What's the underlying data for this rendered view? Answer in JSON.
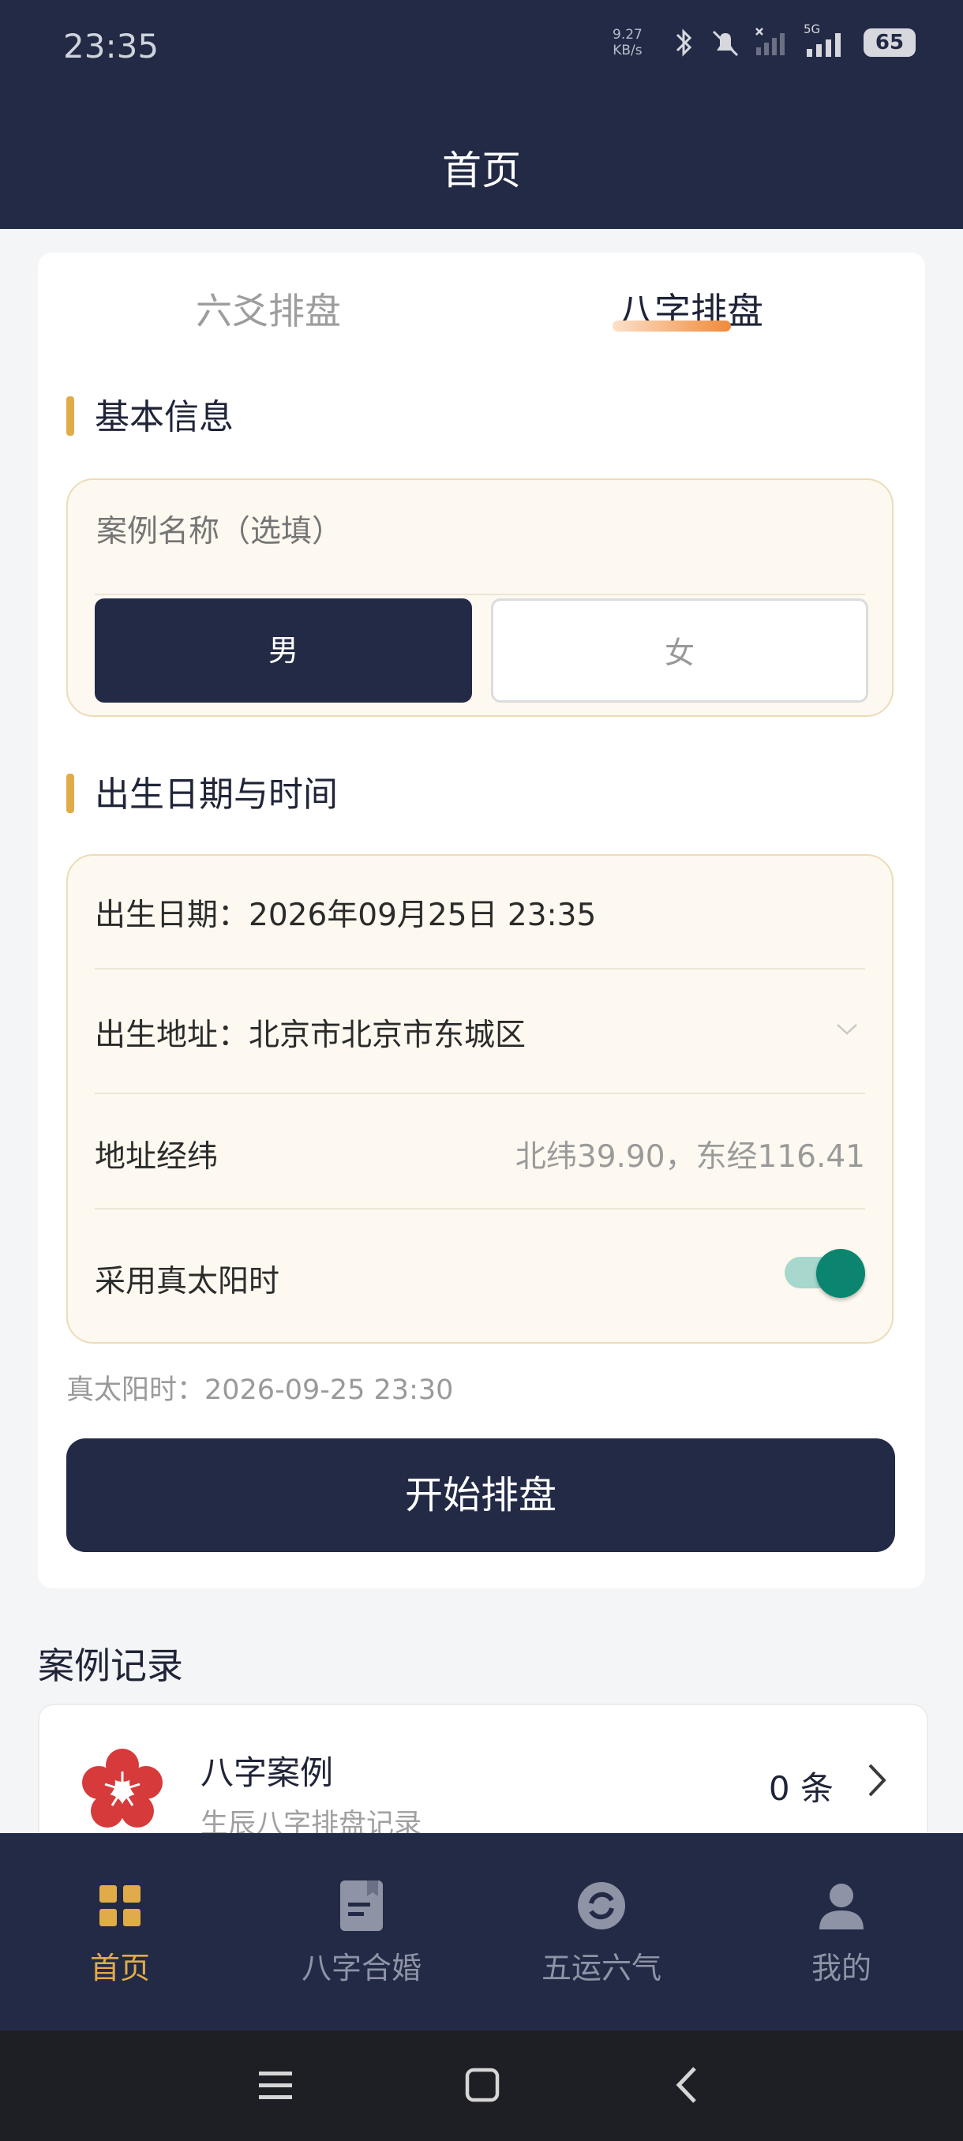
{
  "status_bar": {
    "time": "23:35",
    "net_speed_value": "9.27",
    "net_speed_unit": "KB/s",
    "network": "5G",
    "battery": "65"
  },
  "header": {
    "title": "首页"
  },
  "tabs": [
    {
      "label": "六爻排盘",
      "active": false
    },
    {
      "label": "八字排盘",
      "active": true
    }
  ],
  "basic_info": {
    "title": "基本信息",
    "case_name_placeholder": "案例名称（选填）",
    "gender": {
      "male": "男",
      "female": "女",
      "selected": "男"
    }
  },
  "birth": {
    "title": "出生日期与时间",
    "date_row": "出生日期：2026年09月25日 23:35",
    "address_row": "出生地址：北京市北京市东城区",
    "coords_label": "地址经纬",
    "coords_value": "北纬39.90，东经116.41",
    "true_solar_label": "采用真太阳时",
    "true_solar_enabled": true
  },
  "true_solar_note": "真太阳时：2026-09-25 23:30",
  "start_button": "开始排盘",
  "records": {
    "title": "案例记录",
    "items": [
      {
        "name": "八字案例",
        "subtitle": "生辰八字排盘记录",
        "count": "0 条"
      }
    ]
  },
  "bottom_nav": [
    {
      "label": "首页",
      "icon": "home-grid-icon",
      "active": true
    },
    {
      "label": "八字合婚",
      "icon": "book-icon",
      "active": false
    },
    {
      "label": "五运六气",
      "icon": "cycle-icon",
      "active": false
    },
    {
      "label": "我的",
      "icon": "person-icon",
      "active": false
    }
  ],
  "colors": {
    "primary": "#232a45",
    "accent_gold": "#e0ac4a",
    "toggle_on": "#0b8570",
    "tab_underline": "#f08a3a",
    "inactive_nav": "#8e93a6"
  }
}
